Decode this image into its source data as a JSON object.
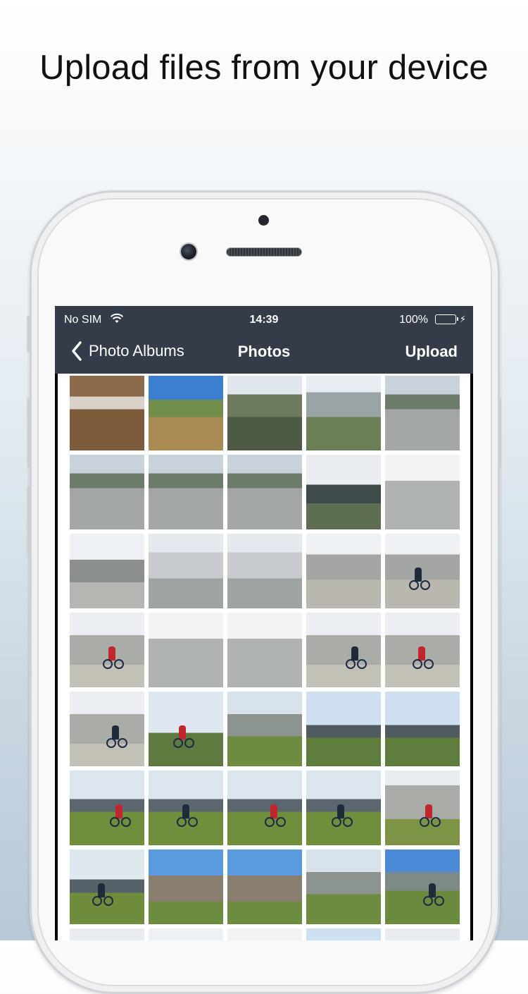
{
  "headline": "Upload files from your device",
  "status_bar": {
    "carrier": "No SIM",
    "time": "14:39",
    "battery_percent": "100%",
    "icons": [
      "wifi-icon",
      "battery-icon",
      "charging-icon"
    ]
  },
  "nav": {
    "back_label": "Photo Albums",
    "title": "Photos",
    "action_label": "Upload",
    "back_icon": "chevron-left-icon",
    "bar_color": "#333c48"
  },
  "photos": [
    {
      "scene": "cafe"
    },
    {
      "scene": "portrait"
    },
    {
      "scene": "village"
    },
    {
      "scene": "group-mountains"
    },
    {
      "scene": "cafe-bikes"
    },
    {
      "scene": "cafe-bikes"
    },
    {
      "scene": "cafe-bikes"
    },
    {
      "scene": "cafe-bikes"
    },
    {
      "scene": "cloudy-peaks"
    },
    {
      "scene": "misty-rock"
    },
    {
      "scene": "rock-road"
    },
    {
      "scene": "viewpoint-group"
    },
    {
      "scene": "viewpoint-group"
    },
    {
      "scene": "gravel-trail"
    },
    {
      "scene": "gravel-trail-rider"
    },
    {
      "scene": "gravel-rider"
    },
    {
      "scene": "misty-rock"
    },
    {
      "scene": "misty-rock"
    },
    {
      "scene": "gravel-rider"
    },
    {
      "scene": "gravel-rider"
    },
    {
      "scene": "gravel-rider"
    },
    {
      "scene": "hill-group"
    },
    {
      "scene": "meadow-bike"
    },
    {
      "scene": "green-valley"
    },
    {
      "scene": "green-valley"
    },
    {
      "scene": "meadow-rider"
    },
    {
      "scene": "meadow-rider"
    },
    {
      "scene": "meadow-rider"
    },
    {
      "scene": "meadow-rider"
    },
    {
      "scene": "rock-rider"
    },
    {
      "scene": "meadow-pair"
    },
    {
      "scene": "chapel"
    },
    {
      "scene": "chapel"
    },
    {
      "scene": "meadow-bike"
    },
    {
      "scene": "green-valley-bike"
    },
    {
      "scene": "cloudy-peaks"
    },
    {
      "scene": "rock-road"
    },
    {
      "scene": "misty-rock"
    },
    {
      "scene": "green-valley"
    },
    {
      "scene": "cloudy-peaks"
    }
  ]
}
